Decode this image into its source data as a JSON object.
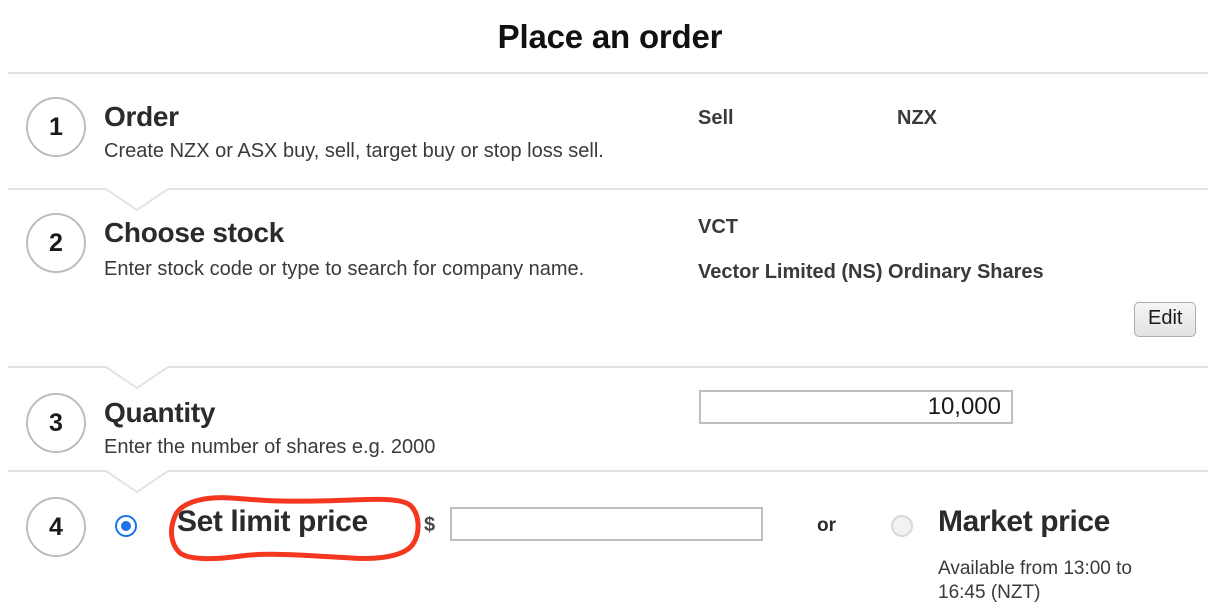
{
  "page": {
    "title": "Place an order"
  },
  "steps": [
    {
      "number": "1",
      "title": "Order",
      "description": "Create NZX or ASX buy, sell, target buy or stop loss sell.",
      "value_primary": "Sell",
      "value_secondary": "NZX"
    },
    {
      "number": "2",
      "title": "Choose stock",
      "description": "Enter stock code or type to search for company name.",
      "stock_code": "VCT",
      "stock_name": "Vector Limited (NS) Ordinary Shares",
      "edit_label": "Edit"
    },
    {
      "number": "3",
      "title": "Quantity",
      "description": "Enter the number of shares e.g. 2000",
      "quantity_value": "10,000",
      "quantity_placeholder": ""
    },
    {
      "number": "4",
      "limit_option_label": "Set limit price",
      "limit_selected": true,
      "currency_symbol": "$",
      "limit_price_value": "",
      "limit_price_placeholder": "",
      "or_label": "or",
      "market_option_label": "Market price",
      "market_selected": false,
      "market_availability": "Available from 13:00 to 16:45 (NZT)"
    }
  ],
  "annotation": {
    "target": "Set limit price",
    "color": "#f4381f",
    "shape": "hand-drawn-ellipse"
  },
  "colors": {
    "accent_blue": "#1a73e8",
    "divider": "#e3e3e3",
    "text": "#333333",
    "annotation_red": "#f4381f"
  }
}
